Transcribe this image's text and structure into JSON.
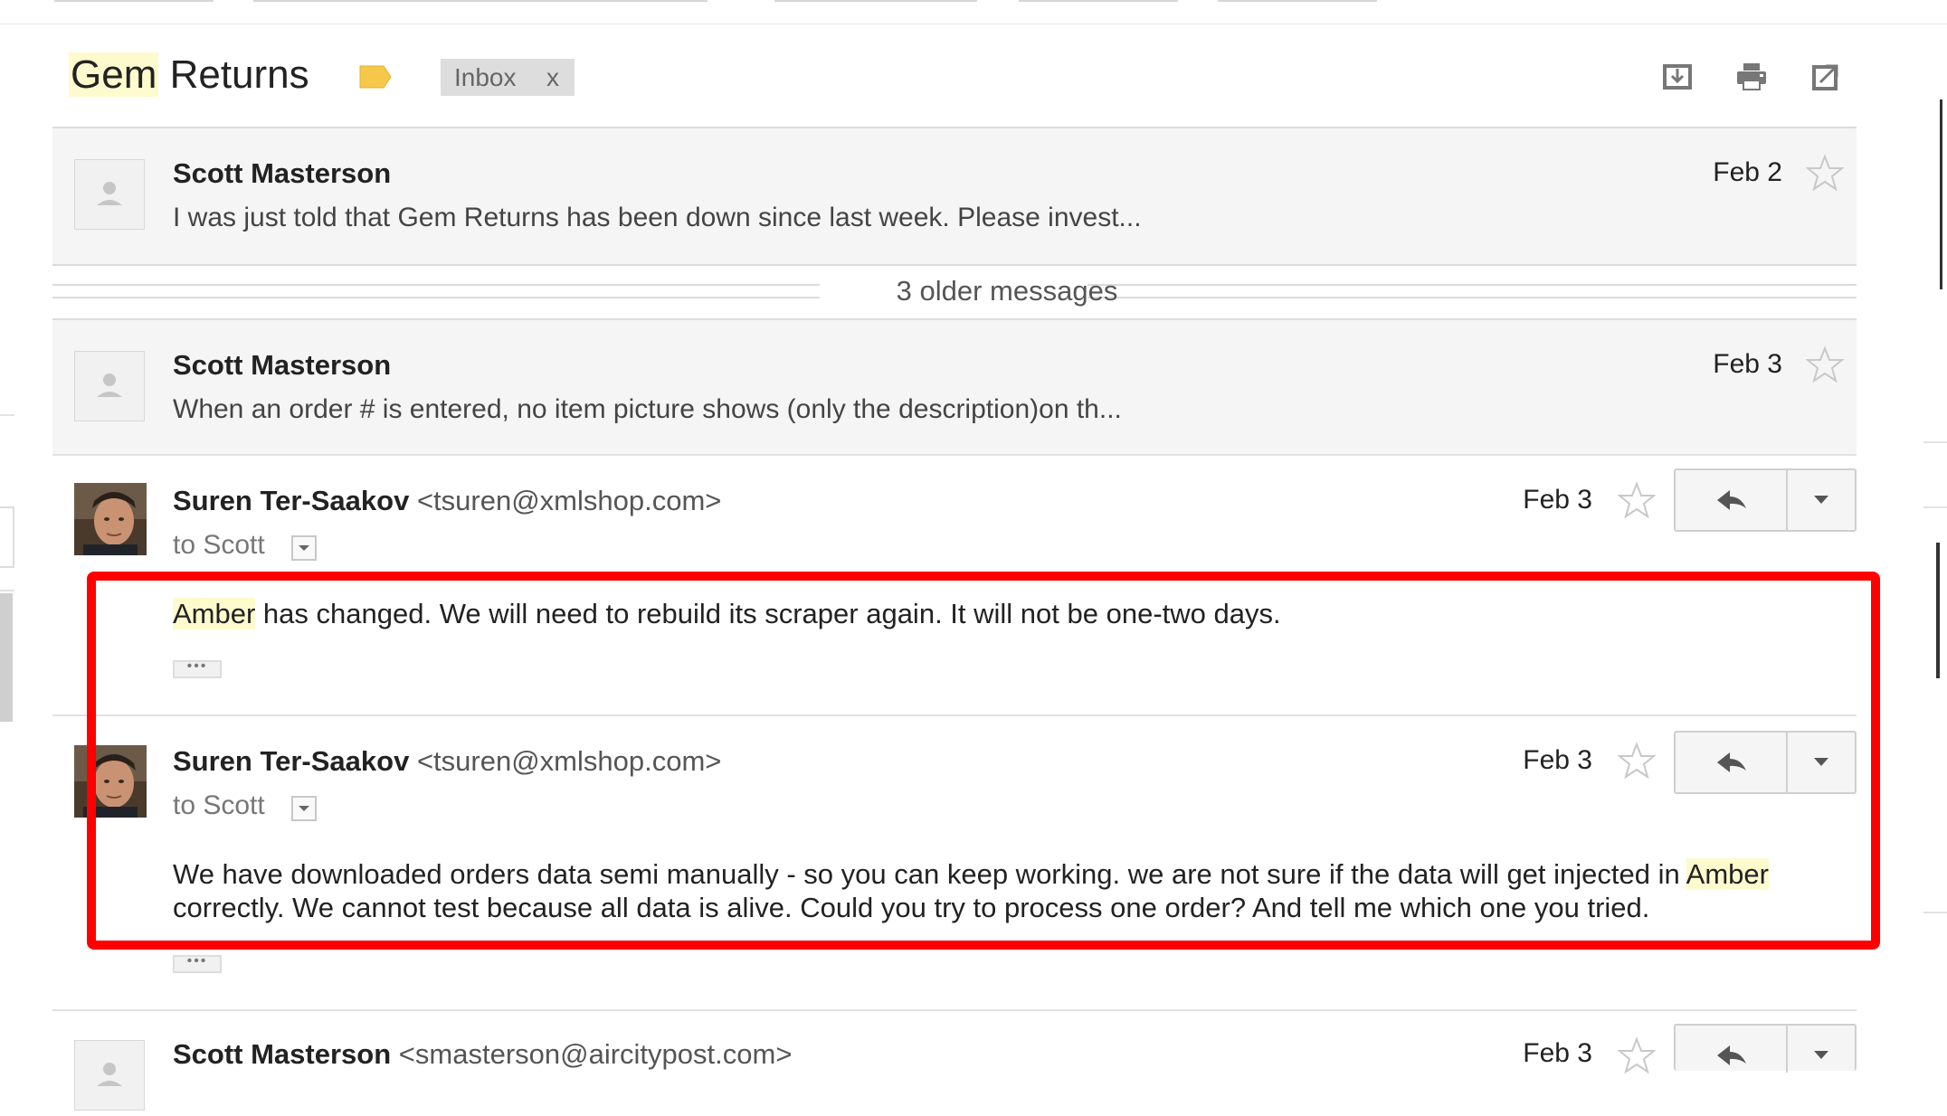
{
  "thread": {
    "subject_highlight": "Gem",
    "subject_rest": " Returns",
    "label": "Inbox",
    "label_remove": "x",
    "tools": [
      "download-icon",
      "print-icon",
      "new-window-icon"
    ]
  },
  "older_messages": "3 older messages",
  "collapsed": [
    {
      "sender": "Scott Masterson",
      "snippet": "I was just told that Gem Returns has been down since last week. Please invest...",
      "date": "Feb 2"
    },
    {
      "sender": "Scott Masterson",
      "snippet": "When an order # is entered, no item picture shows (only the description)on th...",
      "date": "Feb 3"
    }
  ],
  "messages": [
    {
      "sender": "Suren Ter-Saakov",
      "email": "<tsuren@xmlshop.com>",
      "to": "to Scott",
      "date": "Feb 3",
      "body_hl": "Amber",
      "body_rest": " has changed. We will need to rebuild its scraper again. It will not be one-two days."
    },
    {
      "sender": "Suren Ter-Saakov",
      "email": "<tsuren@xmlshop.com>",
      "to": "to Scott",
      "date": "Feb 3",
      "body_line1_pre": "We have downloaded orders data semi manually - so you can keep working. we are not sure if the data will get injected in ",
      "body_line1_hl": "Amber",
      "body_line2": "correctly. We cannot test because all data is alive. Could you try to process one order? And tell me which one you tried."
    },
    {
      "sender": "Scott Masterson",
      "email": "<smasterson@aircitypost.com>",
      "date": "Feb 3"
    }
  ],
  "ellipsis": "•••",
  "colors": {
    "highlight": "#fdfbcd",
    "label_tag": "#f5c84c",
    "annotation_red": "#ff0000"
  }
}
